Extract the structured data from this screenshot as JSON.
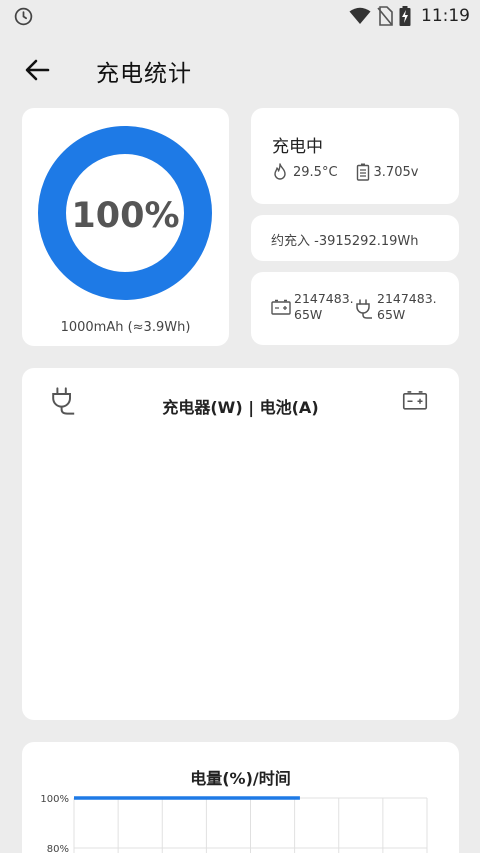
{
  "status_bar": {
    "time": "11:19",
    "icons": [
      "clock-icon",
      "wifi-icon",
      "no-sim-icon",
      "battery-charging-icon"
    ]
  },
  "app_bar": {
    "title": "充电统计",
    "back_icon": "arrow-left-icon"
  },
  "battery_ring": {
    "percent_label": "100%",
    "level": 1.0,
    "capacity": "1000mAh (≈3.9Wh)",
    "ring_color": "#1e7ae6"
  },
  "status_card": {
    "title": "充电中",
    "temperature": "29.5°C",
    "voltage": "3.705v",
    "temperature_icon": "flame-icon",
    "voltage_icon": "battery-icon"
  },
  "energy_card": {
    "text": "约充入 -3915292.19Wh"
  },
  "power_card": {
    "battery_power": "2147483.65W",
    "charger_power": "2147483.65W",
    "battery_icon": "battery-plus-icon",
    "charger_icon": "plug-icon"
  },
  "power_graph": {
    "title": "充电器(W) | 电池(A)",
    "left_icon": "plug-icon",
    "right_icon": "battery-plus-icon"
  },
  "chart_data": {
    "type": "line",
    "title": "电量(%)/时间",
    "ylabel": "",
    "xlabel": "",
    "y_ticks": [
      "100%",
      "80%"
    ],
    "series": [
      {
        "values": [
          100,
          100,
          100,
          100,
          100
        ],
        "color": "#1e7ae6"
      }
    ],
    "ylim": [
      80,
      100
    ],
    "grid": true
  }
}
